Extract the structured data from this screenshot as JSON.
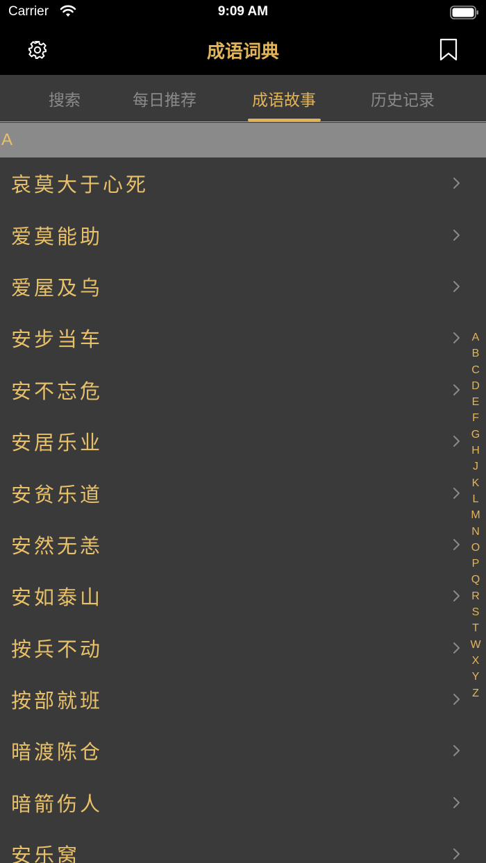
{
  "status": {
    "carrier": "Carrier",
    "time": "9:09 AM"
  },
  "nav": {
    "title": "成语词典",
    "settings_icon": "gear-icon",
    "bookmark_icon": "bookmark-icon"
  },
  "tabs": [
    {
      "label": "搜索"
    },
    {
      "label": "每日推荐"
    },
    {
      "label": "成语故事"
    },
    {
      "label": "历史记录"
    }
  ],
  "active_tab": "成语故事",
  "section": {
    "letter": "A"
  },
  "items": [
    "哀莫大于心死",
    "爱莫能助",
    "爱屋及乌",
    "安步当车",
    "安不忘危",
    "安居乐业",
    "安贫乐道",
    "安然无恙",
    "安如泰山",
    "按兵不动",
    "按部就班",
    "暗渡陈仓",
    "暗箭伤人",
    "安乐窝"
  ],
  "index_letters": [
    "A",
    "B",
    "C",
    "D",
    "E",
    "F",
    "G",
    "H",
    "J",
    "K",
    "L",
    "M",
    "N",
    "O",
    "P",
    "Q",
    "R",
    "S",
    "T",
    "W",
    "X",
    "Y",
    "Z"
  ],
  "colors": {
    "accent": "#e2b55b",
    "background": "#3a3a3a",
    "header": "#000000",
    "section": "#8a8a8a"
  }
}
